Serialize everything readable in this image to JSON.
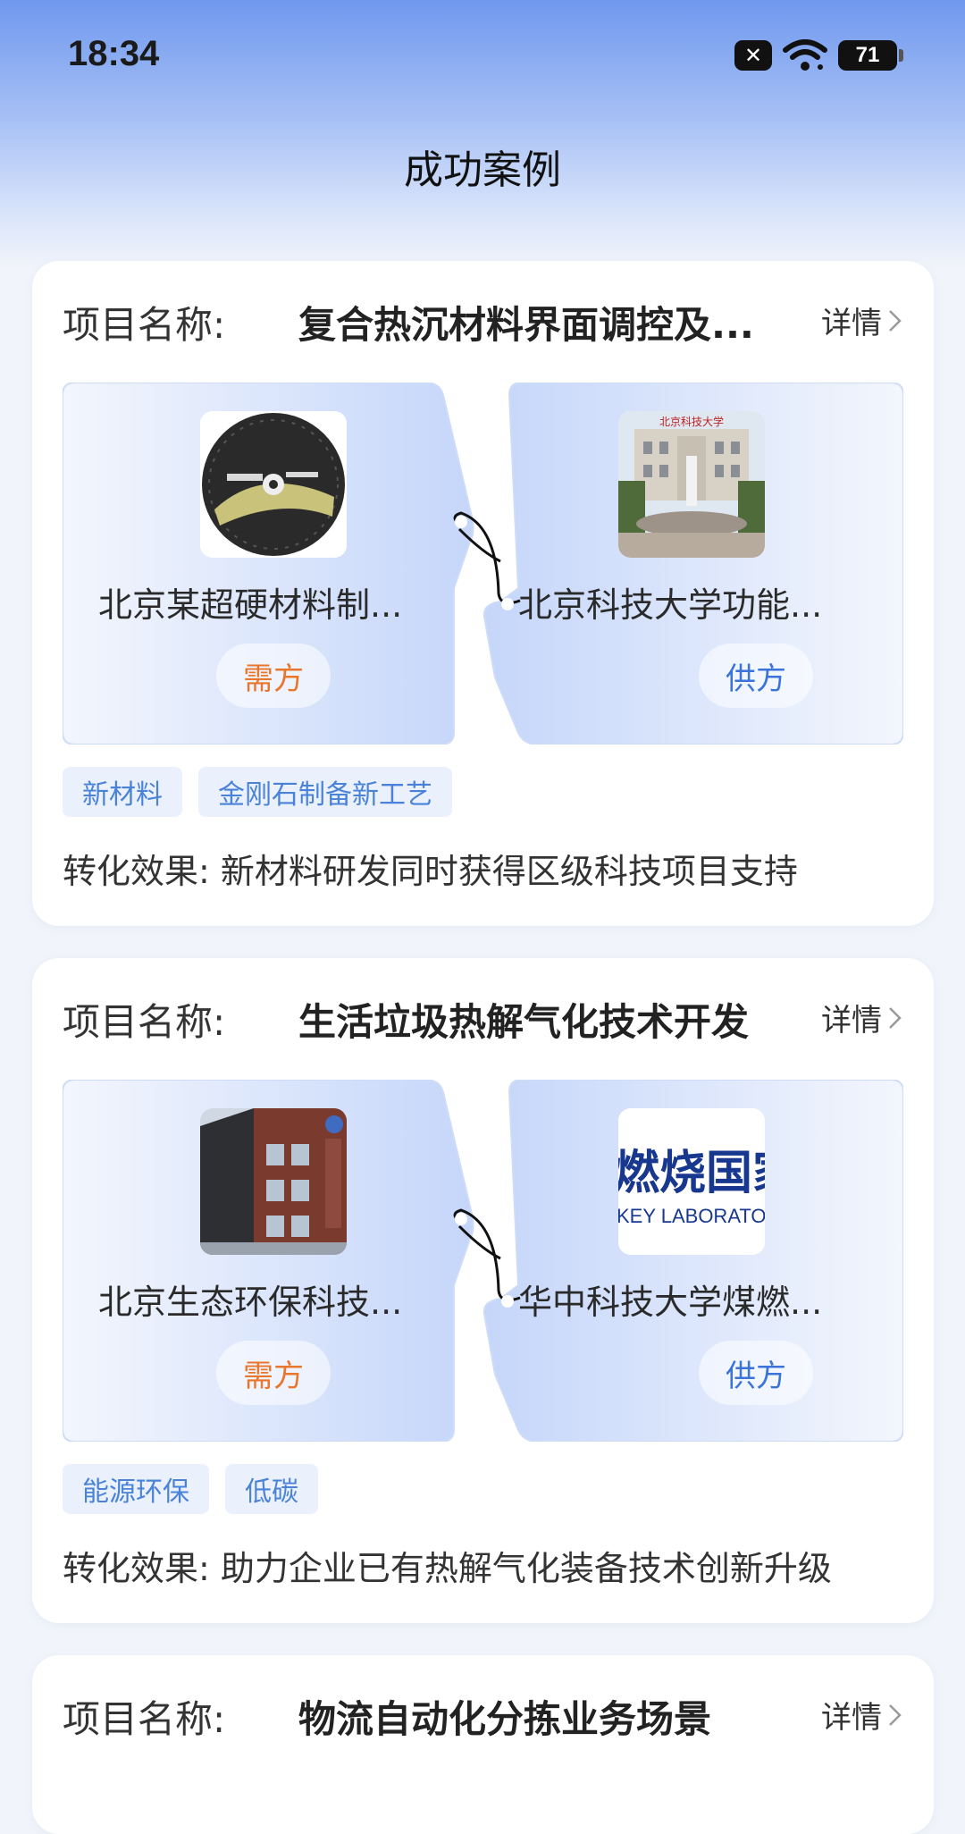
{
  "status_bar": {
    "time": "18:34",
    "battery": "71"
  },
  "page_title": "成功案例",
  "cards": [
    {
      "label": "项目名称:",
      "name": "复合热沉材料界面调控及...",
      "detail": "详情",
      "demand": {
        "org": "北京某超硬材料制...",
        "role": "需方",
        "logo": "saw-blade-logo"
      },
      "supply": {
        "org": "北京科技大学功能...",
        "role": "供方",
        "logo": "university-building-logo"
      },
      "tags": [
        "新材料",
        "金刚石制备新工艺"
      ],
      "effect": "转化效果:  新材料研发同时获得区级科技项目支持"
    },
    {
      "label": "项目名称:",
      "name": "生活垃圾热解气化技术开发",
      "detail": "详情",
      "demand": {
        "org": "北京生态环保科技...",
        "role": "需方",
        "logo": "company-building-logo"
      },
      "supply": {
        "org": "华中科技大学煤燃...",
        "role": "供方",
        "logo": "key-laboratory-logo"
      },
      "tags": [
        "能源环保",
        "低碳"
      ],
      "effect": "转化效果:  助力企业已有热解气化装备技术创新升级"
    },
    {
      "label": "项目名称:",
      "name": "物流自动化分拣业务场景",
      "detail": "详情"
    }
  ],
  "logo_text": {
    "key_lab_cn": "燃烧国家",
    "key_lab_en": "KEY LABORATO"
  },
  "colors": {
    "accent": "#3a73d9",
    "demand": "#e8762c",
    "tag_text": "#4a82d8",
    "tag_bg": "#eaf1fd"
  }
}
